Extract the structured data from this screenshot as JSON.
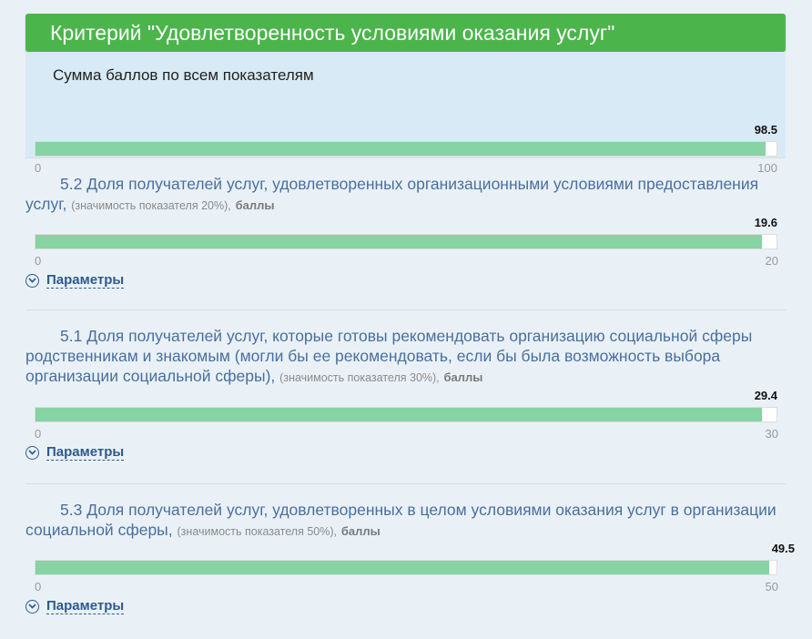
{
  "header": {
    "title": "Критерий \"Удовлетворенность условиями оказания услуг\""
  },
  "summary": {
    "label": "Сумма баллов по всем показателям",
    "value": 98.5,
    "value_text": "98.5",
    "min": "0",
    "max": "100",
    "max_value": 100
  },
  "indicators": [
    {
      "title": "5.2 Доля получателей услуг, удовлетворенных организационными условиями предоставления услуг,",
      "note": "(значимость показателя 20%),",
      "unit": "баллы",
      "value": 19.6,
      "value_text": "19.6",
      "min": "0",
      "max": "20",
      "max_value": 20,
      "params_label": "Параметры"
    },
    {
      "title": "5.1 Доля получателей услуг, которые готовы рекомендовать организацию социальной сферы родственникам и знакомым (могли бы ее рекомендовать, если бы была возможность выбора организации социальной сферы),",
      "note": "(значимость показателя 30%),",
      "unit": "баллы",
      "value": 29.4,
      "value_text": "29.4",
      "min": "0",
      "max": "30",
      "max_value": 30,
      "params_label": "Параметры"
    },
    {
      "title": "5.3 Доля получателей услуг, удовлетворенных в целом условиями оказания услуг в организации социальной сферы,",
      "note": "(значимость показателя 50%),",
      "unit": "баллы",
      "value": 49.5,
      "value_text": "49.5",
      "min": "0",
      "max": "50",
      "max_value": 50,
      "params_label": "Параметры"
    }
  ],
  "colors": {
    "header_bg": "#4bb54b",
    "bar_fill": "#86d3a4",
    "title_blue": "#4a6f9d",
    "link_blue": "#2e5a8c"
  },
  "icons": {
    "params": "chevron-down-circle-icon"
  }
}
